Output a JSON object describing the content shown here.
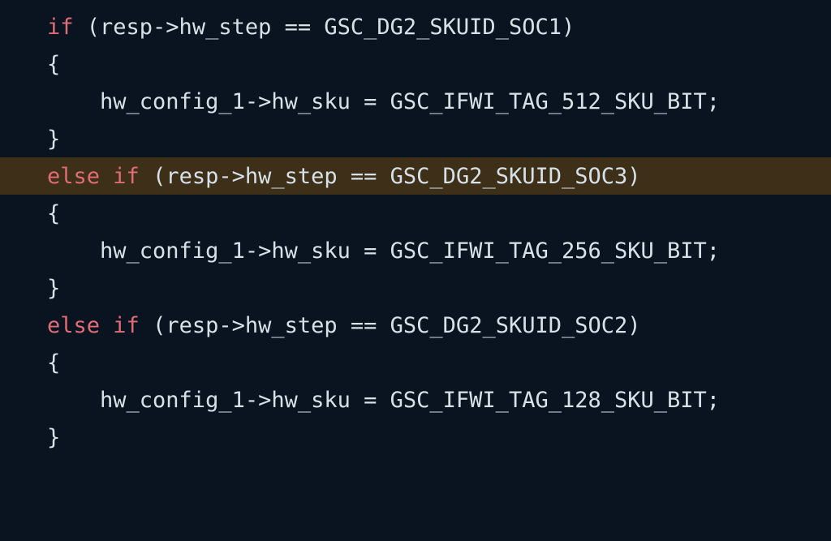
{
  "code": {
    "lines": [
      {
        "type": "if",
        "highlight": false,
        "indent": 0,
        "tokens": [
          {
            "cls": "kw",
            "t": "if"
          },
          {
            "cls": "punc",
            "t": " (resp->hw_step == GSC_DG2_SKUID_SOC1)"
          }
        ]
      },
      {
        "type": "brace",
        "highlight": false,
        "indent": 0,
        "text": "{"
      },
      {
        "type": "stmt",
        "highlight": false,
        "indent": 1,
        "text": "hw_config_1->hw_sku = GSC_IFWI_TAG_512_SKU_BIT;"
      },
      {
        "type": "brace",
        "highlight": false,
        "indent": 0,
        "text": "}"
      },
      {
        "type": "elseif",
        "highlight": true,
        "indent": 0,
        "tokens": [
          {
            "cls": "kw",
            "t": "else"
          },
          {
            "cls": "punc",
            "t": " "
          },
          {
            "cls": "kw",
            "t": "if"
          },
          {
            "cls": "punc",
            "t": " (resp->hw_step == GSC_DG2_SKUID_SOC3)"
          }
        ]
      },
      {
        "type": "brace",
        "highlight": false,
        "indent": 0,
        "text": "{"
      },
      {
        "type": "stmt",
        "highlight": false,
        "indent": 1,
        "text": "hw_config_1->hw_sku = GSC_IFWI_TAG_256_SKU_BIT;"
      },
      {
        "type": "brace",
        "highlight": false,
        "indent": 0,
        "text": "}"
      },
      {
        "type": "elseif",
        "highlight": false,
        "indent": 0,
        "tokens": [
          {
            "cls": "kw",
            "t": "else"
          },
          {
            "cls": "punc",
            "t": " "
          },
          {
            "cls": "kw",
            "t": "if"
          },
          {
            "cls": "punc",
            "t": " (resp->hw_step == GSC_DG2_SKUID_SOC2)"
          }
        ]
      },
      {
        "type": "brace",
        "highlight": false,
        "indent": 0,
        "text": "{"
      },
      {
        "type": "stmt",
        "highlight": false,
        "indent": 1,
        "text": "hw_config_1->hw_sku = GSC_IFWI_TAG_128_SKU_BIT;"
      },
      {
        "type": "brace",
        "highlight": false,
        "indent": 0,
        "text": "}"
      }
    ],
    "indent_unit": "    "
  }
}
